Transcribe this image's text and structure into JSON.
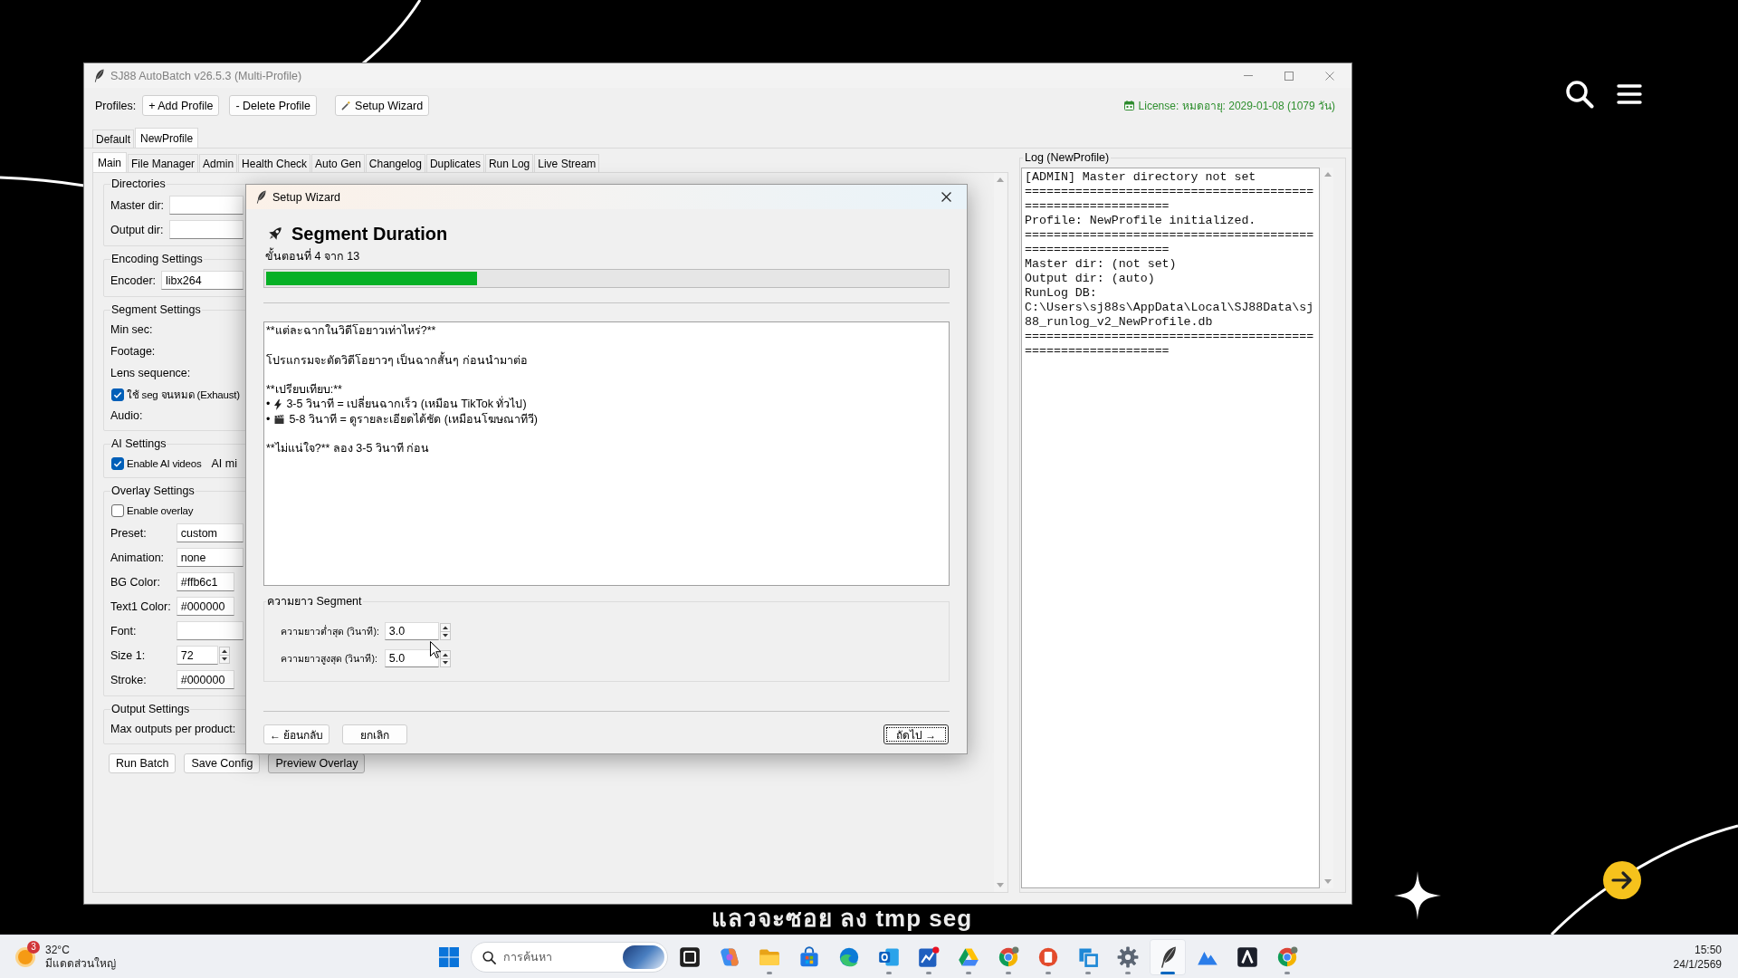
{
  "window": {
    "title": "SJ88 AutoBatch v26.5.3 (Multi-Profile)"
  },
  "toolbar": {
    "label": "Profiles:",
    "buttons": [
      {
        "label": "+ Add Profile",
        "kind": "plain"
      },
      {
        "label": "- Delete Profile",
        "kind": "plain"
      },
      {
        "label": "Setup Wizard",
        "kind": "wizard"
      }
    ],
    "license": "License: หมดอายุ: 2029-01-08 (1079 วัน)"
  },
  "profile_tabs": [
    {
      "label": "Default",
      "selected": false
    },
    {
      "label": "NewProfile",
      "selected": true
    }
  ],
  "tabs": [
    {
      "label": "Main",
      "selected": true
    },
    {
      "label": "File Manager",
      "selected": false
    },
    {
      "label": "Admin",
      "selected": false
    },
    {
      "label": "Health Check",
      "selected": false
    },
    {
      "label": "Auto Gen",
      "selected": false
    },
    {
      "label": "Changelog",
      "selected": false
    },
    {
      "label": "Duplicates",
      "selected": false
    },
    {
      "label": "Run Log",
      "selected": false
    },
    {
      "label": "Live Stream",
      "selected": false
    }
  ],
  "settings": {
    "groups": [
      {
        "title": "Directories",
        "rows": [
          {
            "kind": "entry",
            "label": "Master dir:"
          },
          {
            "kind": "entry",
            "label": "Output dir:"
          }
        ]
      },
      {
        "title": "Encoding Settings",
        "rows": [
          {
            "kind": "entry",
            "label": "Encoder:",
            "value": "libx264"
          }
        ]
      },
      {
        "title": "Segment Settings",
        "rows": [
          {
            "kind": "label",
            "label": "Min sec:"
          },
          {
            "kind": "label",
            "label": "Footage:"
          },
          {
            "kind": "label",
            "label": "Lens sequence:"
          },
          {
            "kind": "check",
            "label": "ใช้ seg จนหมด (Exhaust)",
            "checked": true
          },
          {
            "kind": "label",
            "label": "Audio:"
          }
        ]
      },
      {
        "title": "AI Settings",
        "rows": [
          {
            "kind": "check",
            "label": "Enable AI videos",
            "checked": true,
            "note": "AI mi"
          }
        ]
      },
      {
        "title": "Overlay Settings",
        "rows": [
          {
            "kind": "check",
            "label": "Enable overlay",
            "checked": false
          },
          {
            "kind": "entry",
            "label": "Preset:",
            "value": "custom"
          },
          {
            "kind": "entry",
            "label": "Animation:",
            "value": "none"
          },
          {
            "kind": "color",
            "label": "BG Color:",
            "value": "#ffb6c1"
          },
          {
            "kind": "color",
            "label": "Text1 Color:",
            "value": "#000000"
          },
          {
            "kind": "entry",
            "label": "Font:"
          },
          {
            "kind": "spin",
            "label": "Size 1:",
            "value": "72"
          },
          {
            "kind": "color",
            "label": "Stroke:",
            "value": "#000000"
          }
        ]
      },
      {
        "title": "Output Settings",
        "rows": [
          {
            "kind": "label",
            "label": "Max outputs per product:"
          }
        ]
      }
    ],
    "buttons": [
      {
        "label": "Run Batch",
        "hovered": false
      },
      {
        "label": "Save Config",
        "hovered": false
      },
      {
        "label": "Preview Overlay",
        "hovered": true
      }
    ]
  },
  "log": {
    "title": "Log (NewProfile)",
    "lines": [
      "[ADMIN] Master directory not set",
      "============================================================",
      "Profile: NewProfile initialized.",
      "============================================================",
      "Master dir: (not set)",
      "Output dir: (auto)",
      "RunLog DB: C:\\Users\\sj88s\\AppData\\Local\\SJ88Data\\sj88_runlog_v2_NewProfile.db",
      "============================================================"
    ]
  },
  "wizard": {
    "title": "Setup Wizard",
    "heading": "Segment Duration",
    "step": "ขั้นตอนที่ 4 จาก 13",
    "progress": {
      "level": 0.31
    },
    "body": [
      {
        "lines": [
          {
            "kind": "text",
            "text": "**แต่ละฉากในวิดีโอยาวเท่าไหร่?**"
          }
        ]
      },
      {
        "lines": [
          {
            "kind": "text",
            "text": "โปรแกรมจะตัดวิดีโอยาวๆ เป็นฉากสั้นๆ ก่อนนำมาต่อ"
          }
        ]
      },
      {
        "lines": [
          {
            "kind": "text",
            "text": "**เปรียบเทียบ:**"
          },
          {
            "kind": "bullet",
            "bullet": "•",
            "text": "3-5 วินาที = เปลี่ยนฉากเร็ว (เหมือน TikTok ทั่วไป)"
          },
          {
            "kind": "bullet",
            "bullet": "•",
            "text": "5-8 วินาที = ดูรายละเอียดได้ชัด (เหมือนโฆษณาทีวี)"
          }
        ]
      },
      {
        "lines": [
          {
            "kind": "text",
            "text": "**ไม่แน่ใจ?** ลอง 3-5 วินาที ก่อน"
          }
        ]
      }
    ],
    "group": {
      "title": "ความยาว Segment",
      "fields": [
        {
          "label": "ความยาวต่ำสุด (วินาที):",
          "value": "3.0"
        },
        {
          "label": "ความยาวสูงสุด (วินาที):",
          "value": "5.0"
        }
      ]
    },
    "buttons": [
      {
        "label": "← ย้อนกลับ",
        "focused": false
      },
      {
        "label": "ยกเลิก",
        "focused": false
      },
      {
        "label": "ถัดไป →",
        "focused": true
      }
    ]
  },
  "caption": "แลวจะซอย ลง tmp seg",
  "taskbar": {
    "weather": {
      "badge": "3",
      "temperature": "32°C",
      "condition": "มีแดดส่วนใหญ่"
    },
    "search": {
      "placeholder": "การค้นหา"
    },
    "apps": [
      {
        "kind": "taskview",
        "running": false,
        "active": false
      },
      {
        "kind": "copilot",
        "running": false,
        "active": false
      },
      {
        "kind": "explorer",
        "running": true,
        "active": false
      },
      {
        "kind": "store",
        "running": false,
        "active": false
      },
      {
        "kind": "edge",
        "running": false,
        "active": false
      },
      {
        "kind": "outlook",
        "running": true,
        "active": false
      },
      {
        "kind": "chart",
        "running": true,
        "active": false
      },
      {
        "kind": "drive",
        "running": true,
        "active": false
      },
      {
        "kind": "chrome",
        "running": true,
        "active": false
      },
      {
        "kind": "pdf",
        "running": true,
        "active": false
      },
      {
        "kind": "remote",
        "running": true,
        "active": false
      },
      {
        "kind": "settings",
        "running": true,
        "active": false
      },
      {
        "kind": "feather",
        "running": true,
        "active": true
      },
      {
        "kind": "mountain",
        "running": false,
        "active": false
      },
      {
        "kind": "peak",
        "running": false,
        "active": false
      },
      {
        "kind": "chrome",
        "running": true,
        "active": false
      }
    ],
    "clock": {
      "time": "15:50",
      "date": "24/1/2569"
    }
  }
}
